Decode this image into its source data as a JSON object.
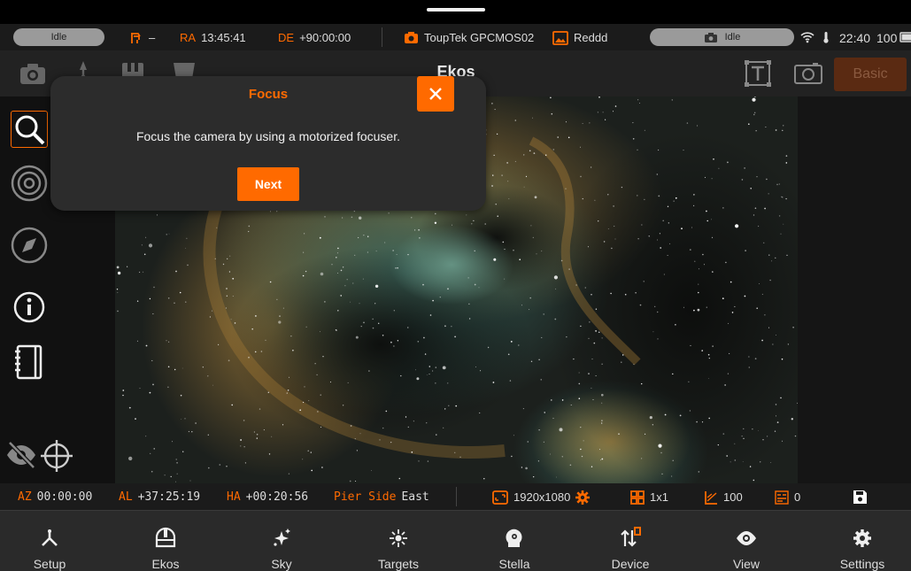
{
  "status_bar": {
    "left_status": "Idle",
    "mount_value": "–",
    "ra_label": "RA",
    "ra_value": "13:45:41",
    "de_label": "DE",
    "de_value": "+90:00:00",
    "camera_name": "ToupTek GPCMOS02",
    "image_name": "Reddd",
    "camera_status": "Idle",
    "clock": "22:40",
    "battery": "100"
  },
  "toolbar": {
    "title": "Ekos",
    "basic_label": "Basic"
  },
  "dialog": {
    "title": "Focus",
    "message": "Focus the camera by using a motorized focuser.",
    "next_label": "Next"
  },
  "info_bar": {
    "az_label": "AZ",
    "az_value": "00:00:00",
    "al_label": "AL",
    "al_value": "+37:25:19",
    "ha_label": "HA",
    "ha_value": "+00:20:56",
    "pier_label": "Pier Side",
    "pier_value": "East",
    "resolution": "1920x1080",
    "binning": "1x1",
    "gain": "100",
    "offset": "0"
  },
  "nav": [
    {
      "label": "Setup",
      "icon": "setup-icon"
    },
    {
      "label": "Ekos",
      "icon": "ekos-icon"
    },
    {
      "label": "Sky",
      "icon": "sky-icon"
    },
    {
      "label": "Targets",
      "icon": "targets-icon"
    },
    {
      "label": "Stella",
      "icon": "stella-icon"
    },
    {
      "label": "Device",
      "icon": "device-icon"
    },
    {
      "label": "View",
      "icon": "view-icon"
    },
    {
      "label": "Settings",
      "icon": "settings-icon"
    }
  ],
  "colors": {
    "accent": "#ff6a00",
    "background": "#111111",
    "panel": "#2c2c2c"
  }
}
